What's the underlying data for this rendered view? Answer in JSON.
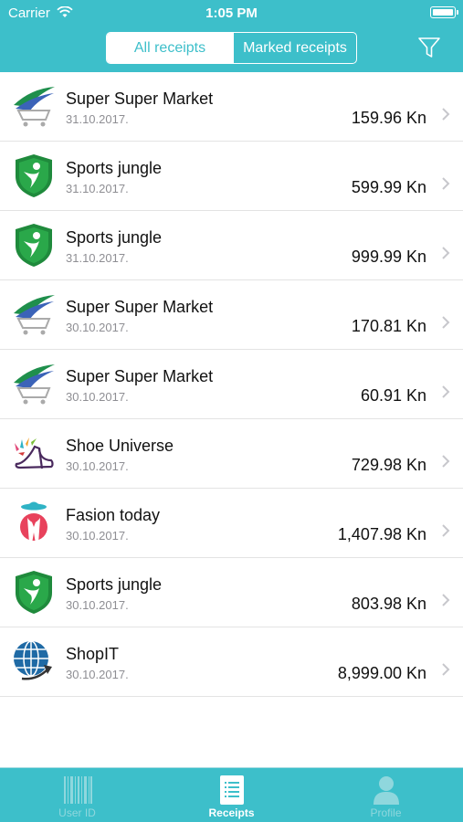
{
  "status_bar": {
    "carrier": "Carrier",
    "time": "1:05 PM"
  },
  "header": {
    "tabs": [
      {
        "label": "All receipts"
      },
      {
        "label": "Marked receipts"
      }
    ]
  },
  "receipts": [
    {
      "name": "Super Super Market",
      "date": "31.10.2017.",
      "amount": "159.96 Kn",
      "logo": "cart"
    },
    {
      "name": "Sports jungle",
      "date": "31.10.2017.",
      "amount": "599.99 Kn",
      "logo": "shield"
    },
    {
      "name": "Sports jungle",
      "date": "31.10.2017.",
      "amount": "999.99 Kn",
      "logo": "shield"
    },
    {
      "name": "Super Super Market",
      "date": "30.10.2017.",
      "amount": "170.81 Kn",
      "logo": "cart"
    },
    {
      "name": "Super Super Market",
      "date": "30.10.2017.",
      "amount": "60.91 Kn",
      "logo": "cart"
    },
    {
      "name": "Shoe Universe",
      "date": "30.10.2017.",
      "amount": "729.98 Kn",
      "logo": "shoe"
    },
    {
      "name": "Fasion today",
      "date": "30.10.2017.",
      "amount": "1,407.98 Kn",
      "logo": "fashion"
    },
    {
      "name": "Sports jungle",
      "date": "30.10.2017.",
      "amount": "803.98 Kn",
      "logo": "shield"
    },
    {
      "name": "ShopIT",
      "date": "30.10.2017.",
      "amount": "8,999.00 Kn",
      "logo": "globe"
    }
  ],
  "tab_bar": [
    {
      "label": "User ID",
      "icon": "barcode-icon"
    },
    {
      "label": "Receipts",
      "icon": "receipt-icon"
    },
    {
      "label": "Profile",
      "icon": "profile-icon"
    }
  ],
  "colors": {
    "accent": "#3dbfca",
    "tab_inactive": "#8fd7dd",
    "separator": "#e3e3e3"
  }
}
